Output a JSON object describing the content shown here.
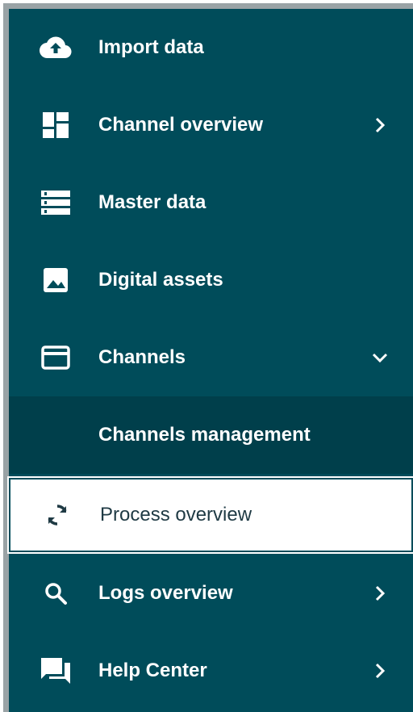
{
  "colors": {
    "sidebar_bg": "#004c5a",
    "submenu_bg": "#003f4b",
    "active_bg": "#ffffff",
    "active_text": "#1f3a44",
    "text": "#ffffff"
  },
  "sidebar": {
    "items": [
      {
        "label": "Import data",
        "icon": "cloud-upload-icon",
        "chevron": "none"
      },
      {
        "label": "Channel overview",
        "icon": "dashboard-icon",
        "chevron": "right"
      },
      {
        "label": "Master data",
        "icon": "list-icon",
        "chevron": "none"
      },
      {
        "label": "Digital assets",
        "icon": "image-icon",
        "chevron": "none"
      },
      {
        "label": "Channels",
        "icon": "window-icon",
        "chevron": "down"
      },
      {
        "label": "Channels management",
        "icon": "",
        "chevron": "none"
      },
      {
        "label": "Process overview",
        "icon": "sync-icon",
        "chevron": "none"
      },
      {
        "label": "Logs overview",
        "icon": "search-icon",
        "chevron": "right"
      },
      {
        "label": "Help Center",
        "icon": "chat-icon",
        "chevron": "right"
      }
    ]
  }
}
